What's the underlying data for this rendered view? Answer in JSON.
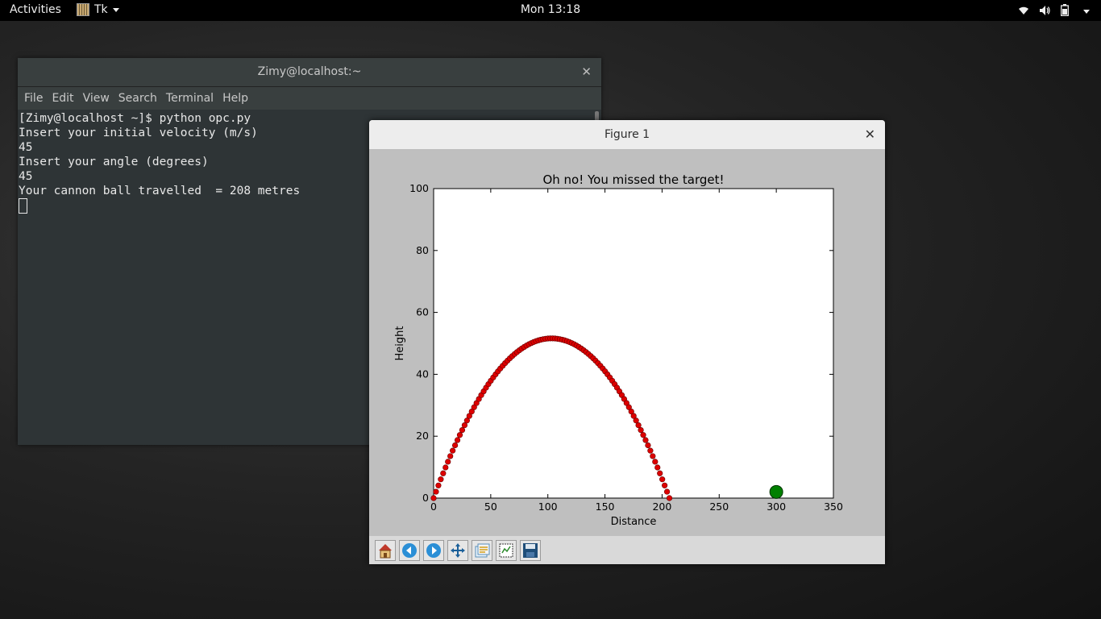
{
  "topbar": {
    "activities": "Activities",
    "app_name": "Tk",
    "clock": "Mon 13:18"
  },
  "terminal": {
    "title": "Zimy@localhost:~",
    "menu": [
      "File",
      "Edit",
      "View",
      "Search",
      "Terminal",
      "Help"
    ],
    "lines": [
      "[Zimy@localhost ~]$ python opc.py",
      "",
      "Insert your initial velocity (m/s)",
      "45",
      "",
      "Insert your angle (degrees)",
      "45",
      "",
      "Your cannon ball travelled  = 208 metres"
    ]
  },
  "figure": {
    "title": "Figure 1"
  },
  "icons": {
    "close": "close-icon",
    "wifi": "wifi-icon",
    "volume": "volume-icon",
    "battery": "battery-icon",
    "toolbar": [
      "home-icon",
      "back-icon",
      "forward-icon",
      "pan-icon",
      "configure-subplots-icon",
      "zoom-rect-icon",
      "save-icon"
    ]
  },
  "chart_data": {
    "type": "scatter",
    "title": "Oh no! You missed the target!",
    "xlabel": "Distance",
    "ylabel": "Height",
    "xlim": [
      0,
      350
    ],
    "ylim": [
      0,
      100
    ],
    "xticks": [
      0,
      50,
      100,
      150,
      200,
      250,
      300,
      350
    ],
    "yticks": [
      0,
      20,
      40,
      60,
      80,
      100
    ],
    "series": [
      {
        "color": "#dd0000",
        "marker": "circle",
        "trajectory": {
          "velocity": 45,
          "angle_deg": 45,
          "g": 9.81,
          "points": 100
        }
      },
      {
        "color": "#008000",
        "marker": "circle-large",
        "x": [
          300
        ],
        "y": [
          2
        ]
      }
    ],
    "grid": false
  }
}
